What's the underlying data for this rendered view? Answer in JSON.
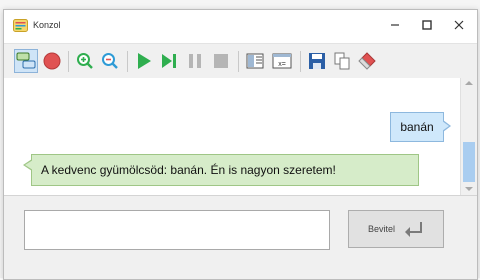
{
  "window": {
    "title": "Konzol",
    "controls": {
      "minimize": "–",
      "maximize": "☐",
      "close": "✕"
    }
  },
  "toolbar": {
    "buttons": [
      {
        "icon": "chat-bubbles-icon",
        "active": true
      },
      {
        "icon": "record-icon"
      },
      {
        "icon": "zoom-in-icon"
      },
      {
        "icon": "zoom-out-icon"
      },
      {
        "icon": "play-icon"
      },
      {
        "icon": "step-icon"
      },
      {
        "icon": "pause-icon"
      },
      {
        "icon": "stop-icon"
      },
      {
        "icon": "split-view-icon"
      },
      {
        "icon": "variable-icon",
        "label": "x="
      },
      {
        "icon": "save-icon"
      },
      {
        "icon": "copy-icon"
      },
      {
        "icon": "eraser-icon"
      }
    ]
  },
  "chat": {
    "messages": [
      {
        "side": "right",
        "text": "banán",
        "color": "#cfe8fb"
      },
      {
        "side": "left",
        "text": "A kedvenc gyümölcsöd: banán. Én is nagyon szeretem!",
        "color": "#d6ecc9"
      }
    ]
  },
  "input": {
    "value": "",
    "placeholder": "",
    "submit_label": "Bevitel"
  },
  "colors": {
    "accent": "#2e9bd6",
    "record": "#e05252",
    "play": "#2fae4f"
  }
}
